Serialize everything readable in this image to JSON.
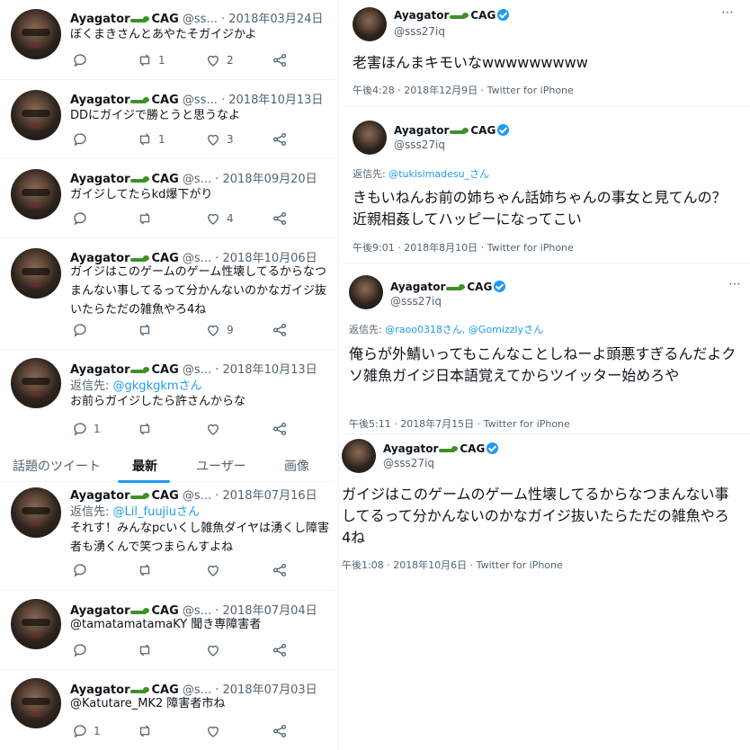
{
  "left": {
    "tweets": [
      {
        "name": "Ayagator",
        "name2": "CAG",
        "handle": "@ss...",
        "date": "· 2018年03月24日",
        "reply_prefix": "",
        "reply_to": "",
        "text": "ぼくまきさんとあやたそガイジかよ",
        "replies": "",
        "retweets": "1",
        "likes": "2"
      },
      {
        "name": "Ayagator",
        "name2": "CAG",
        "handle": "@ss...",
        "date": "· 2018年10月13日",
        "reply_prefix": "",
        "reply_to": "",
        "text": "DDにガイジで勝とうと思うなよ",
        "replies": "",
        "retweets": "1",
        "likes": "3"
      },
      {
        "name": "Ayagator",
        "name2": "CAG",
        "handle": "@s...",
        "date": "· 2018年09月20日",
        "reply_prefix": "",
        "reply_to": "",
        "text": "ガイジしてたらkd爆下がり",
        "replies": "",
        "retweets": "",
        "likes": "4"
      },
      {
        "name": "Ayagator",
        "name2": "CAG",
        "handle": "@s...",
        "date": "· 2018年10月06日",
        "reply_prefix": "",
        "reply_to": "",
        "text": "ガイジはこのゲームのゲーム性壊してるからなつまんない事してるって分かんないのかなガイジ抜いたらただの雑魚やろ4ね",
        "replies": "",
        "retweets": "",
        "likes": "9"
      },
      {
        "name": "Ayagator",
        "name2": "CAG",
        "handle": "@s...",
        "date": "· 2018年10月13日",
        "reply_prefix": "返信先:",
        "reply_to": "@gkgkgkmさん",
        "text": "お前らガイジしたら許さんからな",
        "replies": "1",
        "retweets": "",
        "likes": ""
      },
      {
        "name": "Ayagator",
        "name2": "CAG",
        "handle": "@s...",
        "date": "· 2018年07月16日",
        "reply_prefix": "返信先:",
        "reply_to": "@Lil_fuujiuさん",
        "text": "それす！みんなpcいくし雑魚ダイヤは湧くし障害者も湧くんで笑つまらんすよね",
        "replies": "",
        "retweets": "",
        "likes": ""
      },
      {
        "name": "Ayagator",
        "name2": "CAG",
        "handle": "@s...",
        "date": "· 2018年07月04日",
        "reply_prefix": "",
        "reply_to": "",
        "text": "@tamatamatamaKY 聞き専障害者",
        "replies": "",
        "retweets": "",
        "likes": ""
      },
      {
        "name": "Ayagator",
        "name2": "CAG",
        "handle": "@s...",
        "date": "· 2018年07月03日",
        "reply_prefix": "",
        "reply_to": "",
        "text": "@Katutare_MK2 障害者市ね",
        "replies": "1",
        "retweets": "",
        "likes": ""
      }
    ],
    "tabs": [
      "話題のツイート",
      "最新",
      "ユーザー",
      "画像"
    ]
  },
  "right": {
    "tweets": [
      {
        "name": "Ayagator",
        "name2": "CAG",
        "handle": "@sss27iq",
        "reply_prefix": "",
        "reply_to": "",
        "text": "老害ほんまキモいなwwwwwwwww",
        "meta": "午後4:28 · 2018年12月9日 · Twitter for iPhone"
      },
      {
        "name": "Ayagator",
        "name2": "CAG",
        "handle": "@sss27iq",
        "reply_prefix": "返信先:",
        "reply_to": "@tukisimadesu_さん",
        "text": "きもいねんお前の姉ちゃん話姉ちゃんの事女と見てんの？近親相姦してハッピーになってこい",
        "meta": "午後9:01 · 2018年8月10日 · Twitter for iPhone"
      },
      {
        "name": "Ayagator",
        "name2": "CAG",
        "handle": "@sss27iq",
        "reply_prefix": "返信先:",
        "reply_to": "@raoo0318さん, @Gomizzlyさん",
        "text": "俺らが外鯖いってもこんなことしねーよ頭悪すぎるんだよクソ雑魚ガイジ日本語覚えてからツイッター始めろや",
        "meta": "午後5:11 · 2018年7月15日 · Twitter for iPhone"
      },
      {
        "name": "Ayagator",
        "name2": "CAG",
        "handle": "@sss27iq",
        "reply_prefix": "",
        "reply_to": "",
        "text": "ガイジはこのゲームのゲーム性壊してるからなつまんない事してるって分かんないのかなガイジ抜いたらただの雑魚やろ4ね",
        "meta": "午後1:08 · 2018年10月6日 · Twitter for iPhone"
      }
    ]
  },
  "colors": {
    "accent": "#1d9bf0",
    "muted": "#536471",
    "text": "#0f1419",
    "gator": "#3f8f2a"
  }
}
